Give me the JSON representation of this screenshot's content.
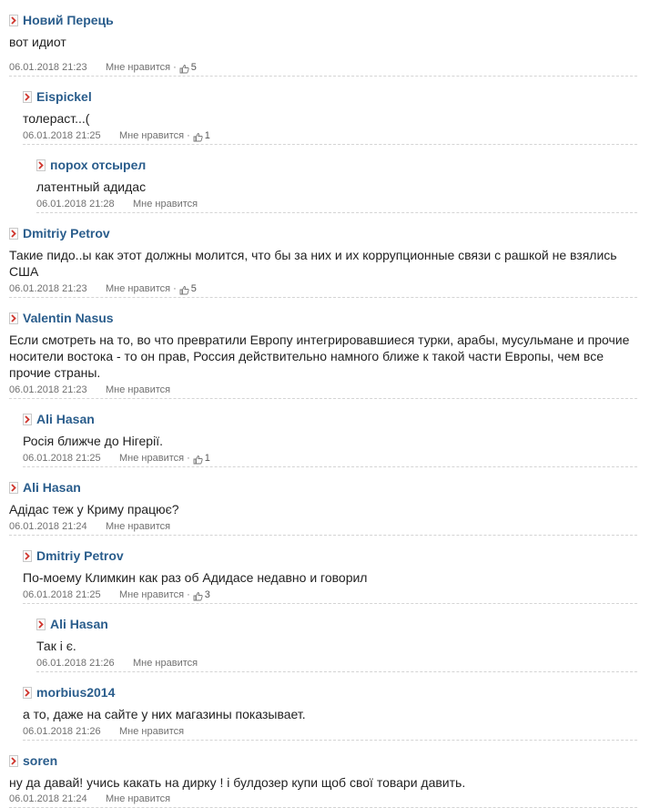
{
  "like_label": "Мне нравится",
  "like_separator": "·",
  "comments": [
    {
      "author": "Новий Перець",
      "text": "вот идиот",
      "date": "06.01.2018 21:23",
      "likes": "5"
    },
    {
      "author": "Eispickel",
      "text": "толераст...(",
      "date": "06.01.2018 21:25",
      "likes": "1"
    },
    {
      "author": "порох отсырел",
      "text": "латентный адидас",
      "date": "06.01.2018 21:28",
      "likes": ""
    },
    {
      "author": "Dmitriy Petrov",
      "text": "Такие пидо..ы как этот должны молится, что бы за них и их коррупционные связи с рашкой не взялись США",
      "date": "06.01.2018 21:23",
      "likes": "5"
    },
    {
      "author": "Valentin Nasus",
      "text": "Если смотреть на то, во что превратили Европу интегрировавшиеся турки, арабы, мусульмане и прочие носители востока - то он прав, Россия действительно намного ближе к такой части Европы, чем все прочие страны.",
      "date": "06.01.2018 21:23",
      "likes": ""
    },
    {
      "author": "Ali Hasan",
      "text": "Росія ближче до Нігерії.",
      "date": "06.01.2018 21:25",
      "likes": "1"
    },
    {
      "author": "Ali Hasan",
      "text": "Адідас теж у Криму працює?",
      "date": "06.01.2018 21:24",
      "likes": ""
    },
    {
      "author": "Dmitriy Petrov",
      "text": "По-моему Климкин как раз об Адидасе недавно и говорил",
      "date": "06.01.2018 21:25",
      "likes": "3"
    },
    {
      "author": "Ali Hasan",
      "text": "Так і є.",
      "date": "06.01.2018 21:26",
      "likes": ""
    },
    {
      "author": "morbius2014",
      "text": "а то, даже на сайте у них магазины показывает.",
      "date": "06.01.2018 21:26",
      "likes": ""
    },
    {
      "author": "soren",
      "text": "ну да давай! учись какать на дирку ! і булдозер купи щоб свої товари давить.",
      "date": "06.01.2018 21:24",
      "likes": ""
    }
  ]
}
